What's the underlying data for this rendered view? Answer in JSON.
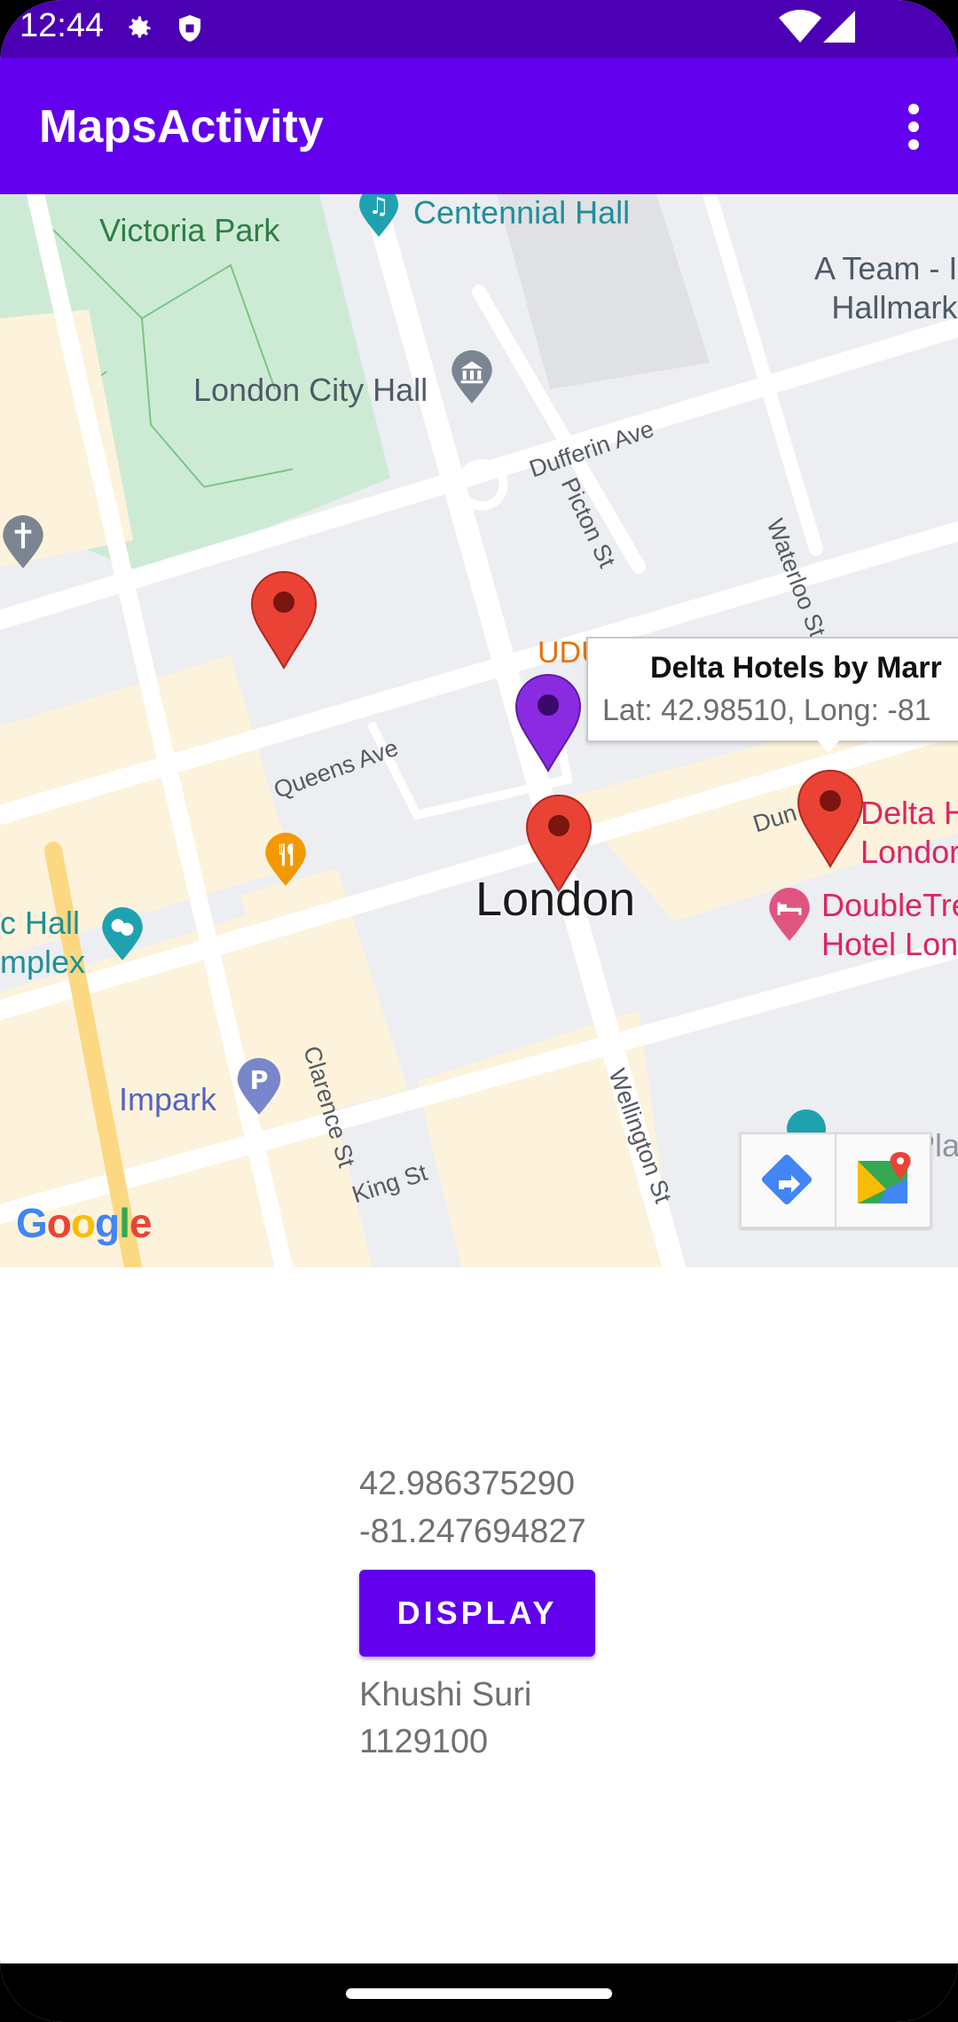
{
  "status_bar": {
    "time": "12:44"
  },
  "app_bar": {
    "title": "MapsActivity"
  },
  "map": {
    "poi": {
      "victoria_park": "Victoria Park",
      "centennial_hall": "Centennial Hall",
      "city_hall": "London City Hall",
      "a_team_line1": "A Team - I",
      "a_team_line2": "Hallmark",
      "udu": "UDU",
      "delta_line1": "Delta H",
      "delta_line2": "Londor",
      "doubletree_line1": "DoubleTre",
      "doubletree_line2": "Hotel Lon",
      "hall_line1": "c Hall",
      "hall_line2": "mplex",
      "impark": "Impark",
      "rbc": "RBC Pla"
    },
    "streets": {
      "dufferin": "Dufferin Ave",
      "picton": "Picton St",
      "waterloo": "Waterloo St",
      "queens": "Queens Ave",
      "dundas": "Dun",
      "clarence": "Clarence St",
      "wellington": "Wellington St",
      "king": "King St"
    },
    "city_label": "London",
    "info_window": {
      "title": "Delta Hotels by Marr",
      "snippet": "Lat: 42.98510, Long: -81"
    },
    "google_logo": "Google",
    "colors": {
      "marker_red": "#ea4335",
      "marker_purple": "#8a2be2"
    }
  },
  "content": {
    "latitude": "42.986375290",
    "longitude": "-81.247694827",
    "display_button": "DISPLAY",
    "name": "Khushi Suri",
    "id": "1129100"
  }
}
